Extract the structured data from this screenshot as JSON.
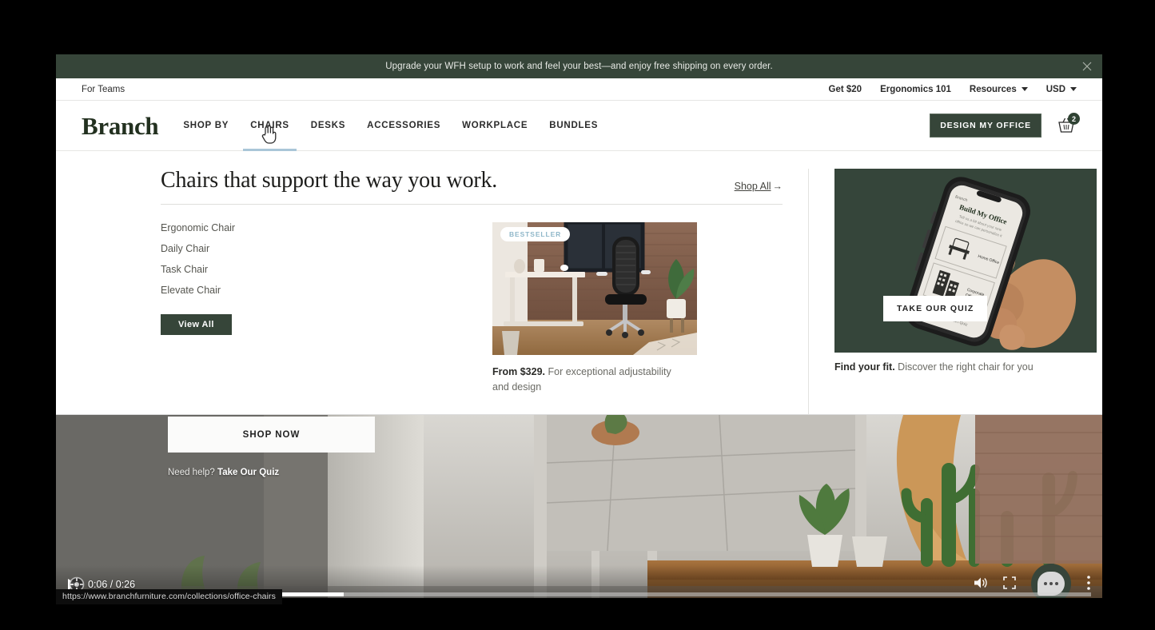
{
  "promo": {
    "text": "Upgrade your WFH setup to work and feel your best—and enjoy free shipping on every order.",
    "close_label": "×",
    "background": "#364539"
  },
  "utility_bar": {
    "left": [
      {
        "label": "For Teams"
      }
    ],
    "right": [
      {
        "label": "Get $20",
        "type": "link"
      },
      {
        "label": "Ergonomics 101",
        "type": "link"
      },
      {
        "label": "Resources",
        "type": "dropdown"
      },
      {
        "label": "USD",
        "type": "dropdown"
      }
    ]
  },
  "header": {
    "logo": "Branch",
    "nav": [
      {
        "label": "SHOP BY",
        "active": false
      },
      {
        "label": "CHAIRS",
        "active": true
      },
      {
        "label": "DESKS",
        "active": false
      },
      {
        "label": "ACCESSORIES",
        "active": false
      },
      {
        "label": "WORKPLACE",
        "active": false
      },
      {
        "label": "BUNDLES",
        "active": false
      }
    ],
    "cta_label": "DESIGN MY OFFICE",
    "cart_count": "2",
    "active_underline_color": "#a9c6d8"
  },
  "mega_menu": {
    "heading": "Chairs that support the way you work.",
    "shop_all_label": "Shop All",
    "shop_all_arrow": "→",
    "categories": [
      {
        "label": "Ergonomic Chair"
      },
      {
        "label": "Daily Chair"
      },
      {
        "label": "Task Chair"
      },
      {
        "label": "Elevate Chair"
      }
    ],
    "view_all_label": "View All",
    "featured": {
      "badge": "BESTSELLER",
      "price_label": "From $329.",
      "description": " For exceptional adjustability and design"
    },
    "promo": {
      "button_label": "TAKE OUR QUIZ",
      "caption_bold": "Find your fit.",
      "caption_rest": " Discover the right chair for you",
      "phone_title": "Build My Office",
      "phone_sub": "Tell us a bit about your new office so we can personalize your setup",
      "phone_option_1": "Home Office",
      "phone_option_2": "Corporate Office",
      "phone_brand": "Branch",
      "phone_footer": "Start Quiz",
      "background": "#35453a"
    }
  },
  "hero": {
    "shop_now_label": "SHOP NOW",
    "need_help_prefix": "Need help? ",
    "need_help_link": "Take Our Quiz"
  },
  "video": {
    "current_time": "0:06",
    "separator": " / ",
    "duration": "0:26",
    "time_display": "0:06 / 0:26",
    "progress_percent": "27"
  },
  "status_bar": {
    "url": "https://www.branchfurniture.com/collections/office-chairs"
  }
}
